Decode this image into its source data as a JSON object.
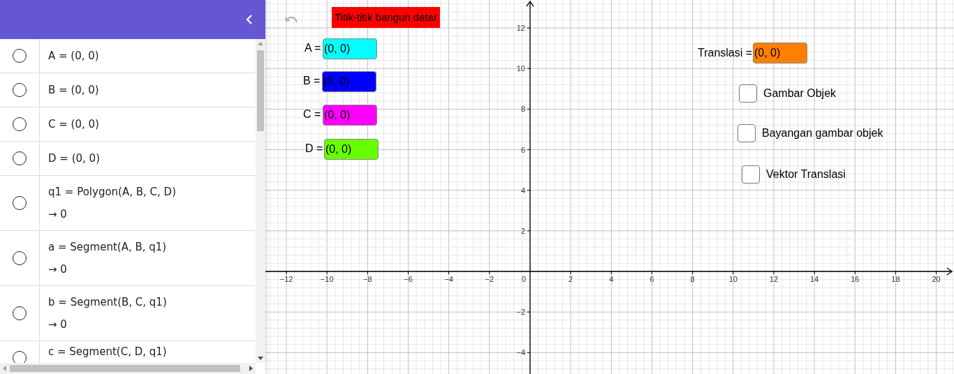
{
  "algebra": {
    "items": [
      {
        "visible": false,
        "text": "A = (0, 0)"
      },
      {
        "visible": false,
        "text": "B = (0, 0)"
      },
      {
        "visible": false,
        "text": "C = (0, 0)"
      },
      {
        "visible": false,
        "text": "D = (0, 0)"
      },
      {
        "visible": false,
        "text": "q1 = Polygon(A, B, C, D)",
        "result": "→  0"
      },
      {
        "visible": false,
        "text": "a = Segment(A, B, q1)",
        "result": "→  0"
      },
      {
        "visible": false,
        "text": "b = Segment(B, C, q1)",
        "result": "→  0"
      },
      {
        "visible": false,
        "text": "c = Segment(C, D, q1)"
      }
    ]
  },
  "graphics": {
    "title": "Titik-titik bangun datar",
    "inputs": [
      {
        "label": "A =",
        "value": "(0, 0)",
        "color": "#00ffff"
      },
      {
        "label": "B =",
        "value": "(0, 0)",
        "color": "#0000ff"
      },
      {
        "label": "C =",
        "value": "(0, 0)",
        "color": "#ff00ff"
      },
      {
        "label": "D =",
        "value": "(0, 0)",
        "color": "#66ff00"
      }
    ],
    "translation": {
      "label": "Translasi =",
      "value": "(0, 0)",
      "color": "#ff8000"
    },
    "checkboxes": [
      {
        "label": "Gambar Objek",
        "checked": false
      },
      {
        "label": "Bayangan gambar objek",
        "checked": false
      },
      {
        "label": "Vektor Translasi",
        "checked": false
      }
    ],
    "y_positive_ticks": [
      "12",
      "10",
      "8",
      "6",
      "4",
      "2"
    ],
    "y_negative_ticks": [
      "−2",
      "−4"
    ],
    "x_negative_ticks": [
      "−12",
      "−10",
      "−8",
      "−6",
      "−4",
      "−2"
    ],
    "origin_label": "0",
    "x_positive_ticks": [
      "2",
      "4",
      "6",
      "8",
      "10",
      "12",
      "14",
      "16",
      "18",
      "20"
    ]
  }
}
